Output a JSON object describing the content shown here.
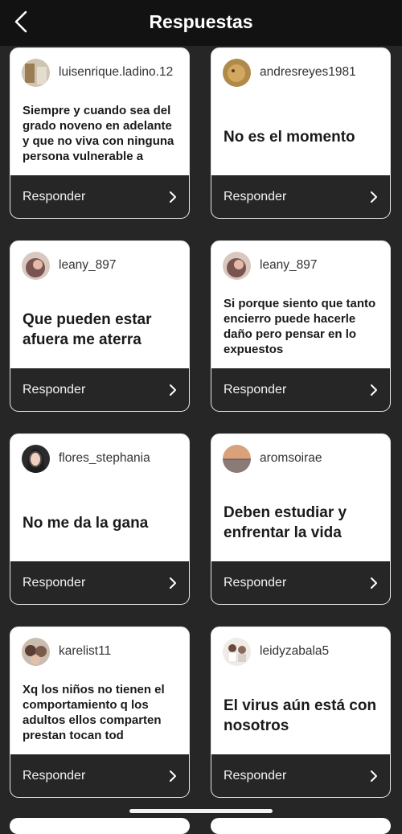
{
  "header": {
    "title": "Respuestas",
    "back_icon": "chevron-left-icon"
  },
  "reply_label": "Responder",
  "cards": [
    {
      "username": "luisenrique.ladino.12",
      "text": "Siempre y cuando sea del grado noveno en adelante y que no viva con ninguna persona vulnerable a",
      "style": "small",
      "avatar_color": "#b69a6e"
    },
    {
      "username": "andresreyes1981",
      "text": "No es el momento",
      "style": "big",
      "avatar_color": "#b08a4a"
    },
    {
      "username": "leany_897",
      "text": "Que pueden estar afuera me aterra",
      "style": "big",
      "avatar_color": "#7a5450"
    },
    {
      "username": "leany_897",
      "text": "Si porque siento que tanto encierro puede hacerle daño pero pensar en lo expuestos",
      "style": "small",
      "avatar_color": "#7a5450"
    },
    {
      "username": "flores_stephania",
      "text": "No me da la gana",
      "style": "big",
      "avatar_color": "#2b2b2b"
    },
    {
      "username": "aromsoirae",
      "text": "Deben estudiar y enfrentar la vida",
      "style": "big",
      "avatar_color": "#c9a07a"
    },
    {
      "username": "karelist11",
      "text": "Xq los niños no tienen el comportamiento q los adultos ellos comparten prestan tocan tod",
      "style": "small",
      "avatar_color": "#8a6a5a"
    },
    {
      "username": "leidyzabala5",
      "text": "El virus aún está con nosotros",
      "style": "big",
      "avatar_color": "#d8d0c8"
    }
  ]
}
